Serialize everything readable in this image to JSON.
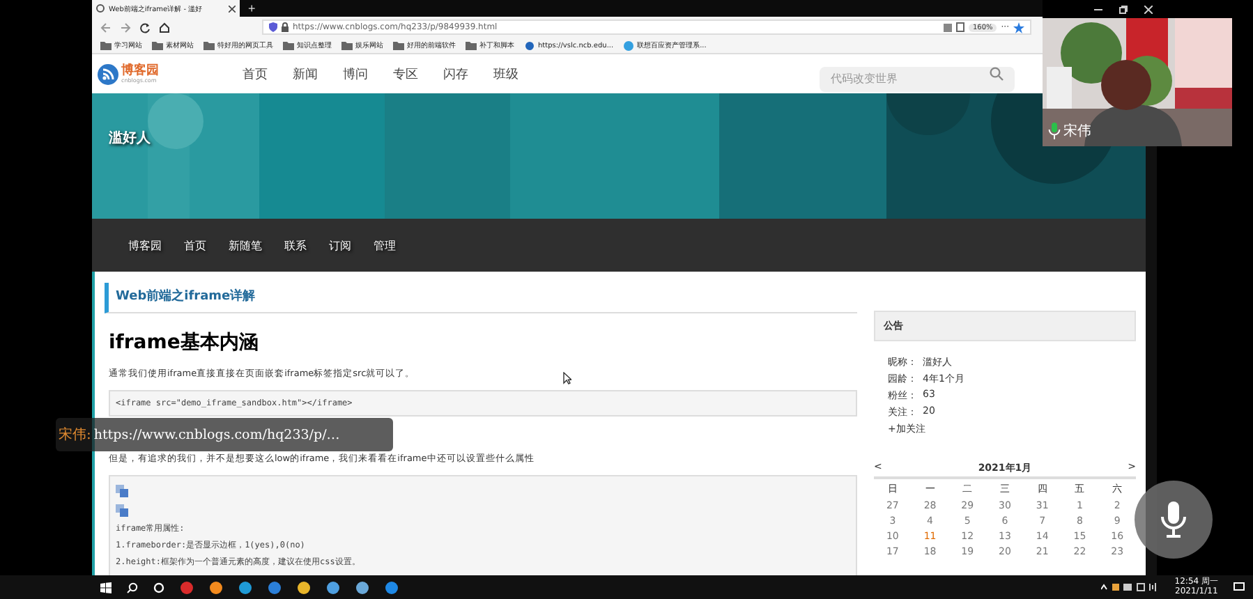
{
  "browser": {
    "tab": {
      "title": "Web前端之iframe详解 - 滥好",
      "selected": true
    },
    "new_tab": "+",
    "url": "https://www.cnblogs.com/hq233/p/9849939.html",
    "zoom": "160%",
    "more": "···",
    "bookmarks": [
      {
        "kind": "folder",
        "label": "学习网站"
      },
      {
        "kind": "folder",
        "label": "素材网站"
      },
      {
        "kind": "folder",
        "label": "特好用的网页工具"
      },
      {
        "kind": "folder",
        "label": "知识点整理"
      },
      {
        "kind": "folder",
        "label": "娱乐网站"
      },
      {
        "kind": "folder",
        "label": "好用的前端软件"
      },
      {
        "kind": "folder",
        "label": "补丁和脚本"
      },
      {
        "kind": "link",
        "label": "https://vslc.ncb.edu..."
      },
      {
        "kind": "site",
        "label": "联想百应资产管理系..."
      }
    ]
  },
  "site_header": {
    "logo": "博客园",
    "logo_sub": "cnblogs.com",
    "nav": [
      "首页",
      "新闻",
      "博问",
      "专区",
      "闪存",
      "班级"
    ],
    "search": {
      "placeholder": "代码改变世界"
    }
  },
  "blog": {
    "title": "滥好人",
    "nav": [
      "博客园",
      "首页",
      "新随笔",
      "联系",
      "订阅",
      "管理"
    ]
  },
  "post": {
    "title": "Web前端之iframe详解",
    "heading": "iframe基本内涵",
    "blocks": [
      {
        "kind": "paragraph",
        "text": "通常我们使用iframe直接直接在页面嵌套iframe标签指定src就可以了。"
      },
      {
        "kind": "code",
        "lines": [
          {
            "kind": "text",
            "text": "<iframe src=\"demo_iframe_sandbox.htm\"></iframe>"
          }
        ]
      },
      {
        "kind": "paragraph",
        "text": "但是，有追求的我们，并不是想要这么low的iframe，我们来看看在iframe中还可以设置些什么属性"
      },
      {
        "kind": "code",
        "lines": [
          {
            "kind": "copy"
          },
          {
            "kind": "copy"
          },
          {
            "kind": "text",
            "text": "iframe常用属性:"
          },
          {
            "kind": "text",
            "text": "1.frameborder:是否显示边框，1(yes),0(no)"
          },
          {
            "kind": "text",
            "text": "2.height:框架作为一个普通元素的高度，建议在使用css设置。"
          }
        ]
      }
    ]
  },
  "sidebar": {
    "notice_title": "公告",
    "profile": [
      {
        "label": "昵称：",
        "value": "滥好人"
      },
      {
        "label": "园龄：",
        "value": "4年1个月"
      },
      {
        "label": "粉丝：",
        "value": "63"
      },
      {
        "label": "关注：",
        "value": "20"
      }
    ],
    "follow": "+加关注",
    "calendar": {
      "prev": "<",
      "month": "2021年1月",
      "next": ">",
      "weekdays": [
        "日",
        "一",
        "二",
        "三",
        "四",
        "五",
        "六"
      ],
      "weeks": [
        [
          {
            "day": "27",
            "today": false
          },
          {
            "day": "28",
            "today": false
          },
          {
            "day": "29",
            "today": false
          },
          {
            "day": "30",
            "today": false
          },
          {
            "day": "31",
            "today": false
          },
          {
            "day": "1",
            "today": false
          },
          {
            "day": "2",
            "today": false
          }
        ],
        [
          {
            "day": "3",
            "today": false
          },
          {
            "day": "4",
            "today": false
          },
          {
            "day": "5",
            "today": false
          },
          {
            "day": "6",
            "today": false
          },
          {
            "day": "7",
            "today": false
          },
          {
            "day": "8",
            "today": false
          },
          {
            "day": "9",
            "today": false
          }
        ],
        [
          {
            "day": "10",
            "today": false
          },
          {
            "day": "11",
            "today": true
          },
          {
            "day": "12",
            "today": false
          },
          {
            "day": "13",
            "today": false
          },
          {
            "day": "14",
            "today": false
          },
          {
            "day": "15",
            "today": false
          },
          {
            "day": "16",
            "today": false
          }
        ],
        [
          {
            "day": "17",
            "today": false
          },
          {
            "day": "18",
            "today": false
          },
          {
            "day": "19",
            "today": false
          },
          {
            "day": "20",
            "today": false
          },
          {
            "day": "21",
            "today": false
          },
          {
            "day": "22",
            "today": false
          },
          {
            "day": "23",
            "today": false
          }
        ]
      ]
    }
  },
  "video": {
    "name": "宋伟"
  },
  "chat": {
    "sender": "宋伟:",
    "message": "https://www.cnblogs.com/hq233/p/…"
  },
  "taskbar": {
    "time": "12:54 周一",
    "date": "2021/1/11"
  }
}
